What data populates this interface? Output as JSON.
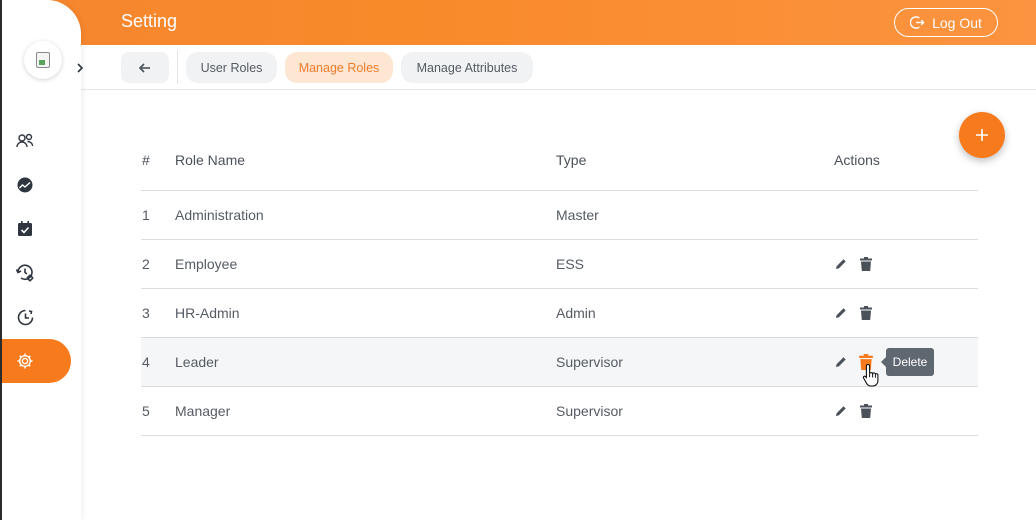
{
  "header": {
    "title": "Setting",
    "logout_label": "Log Out"
  },
  "sidebar": {
    "items": [
      {
        "icon": "users-icon"
      },
      {
        "icon": "gauge-icon"
      },
      {
        "icon": "calendar-check-icon"
      },
      {
        "icon": "history-settings-icon"
      },
      {
        "icon": "clock-icon"
      },
      {
        "icon": "gear-icon",
        "active": true
      }
    ]
  },
  "tabs": {
    "back_icon": "arrow-left-icon",
    "items": [
      {
        "label": "User Roles"
      },
      {
        "label": "Manage Roles",
        "active": true
      },
      {
        "label": "Manage Attributes"
      }
    ]
  },
  "table": {
    "headers": {
      "num": "#",
      "role": "Role Name",
      "type": "Type",
      "actions": "Actions"
    },
    "rows": [
      {
        "num": "1",
        "role": "Administration",
        "type": "Master"
      },
      {
        "num": "2",
        "role": "Employee",
        "type": "ESS"
      },
      {
        "num": "3",
        "role": "HR-Admin",
        "type": "Admin"
      },
      {
        "num": "4",
        "role": "Leader",
        "type": "Supervisor"
      },
      {
        "num": "5",
        "role": "Manager",
        "type": "Supervisor"
      }
    ]
  },
  "tooltip": {
    "text": "Delete"
  },
  "colors": {
    "accent": "#f77a1c",
    "active_tab_bg": "#fde7d3",
    "tooltip_bg": "#5f6770"
  }
}
